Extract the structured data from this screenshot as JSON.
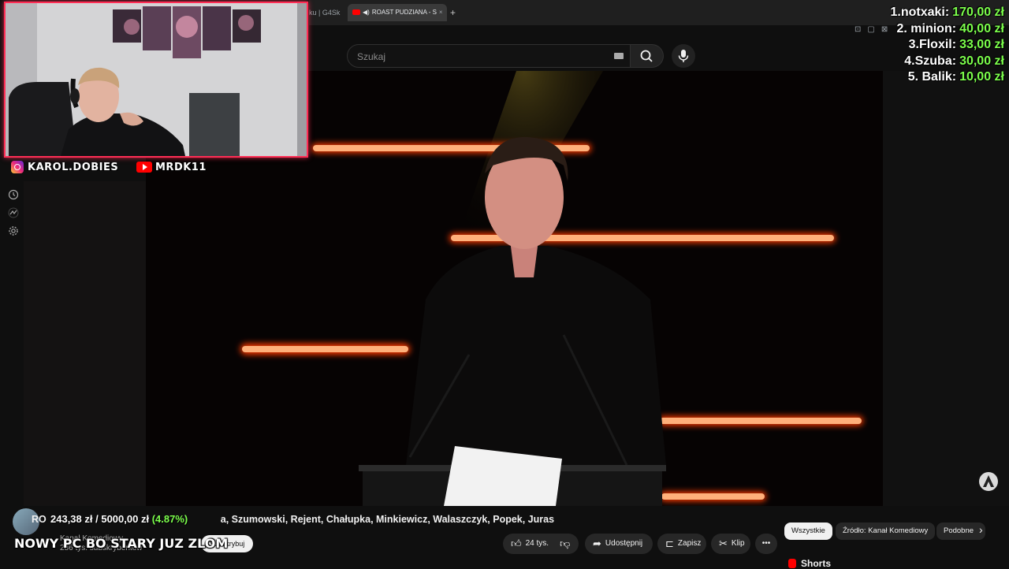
{
  "browser": {
    "prev_tab_label": "ku | G4Sk",
    "active_tab_label": "ROAST PUDZIANA - S",
    "new_tab_symbol": "+"
  },
  "search": {
    "placeholder": "Szukaj"
  },
  "overlay": {
    "instagram_handle": "KAROL.DOBIES",
    "youtube_handle": "MRDK11",
    "stream_title": "NOWY PC BO STARY JUZ ZLOM",
    "donation_goal": {
      "current": "243,38 zł",
      "separator": " / ",
      "target": "5000,00 zł",
      "percent": "(4.87%)"
    }
  },
  "leaderboard": [
    {
      "rank_name": "1.notxaki:",
      "amount": "170,00 zł"
    },
    {
      "rank_name": "2. minion:",
      "amount": "40,00 zł"
    },
    {
      "rank_name": "3.Floxil:",
      "amount": "33,00 zł"
    },
    {
      "rank_name": "4.Szuba:",
      "amount": "30,00 zł"
    },
    {
      "rank_name": "5. Balik:",
      "amount": "10,00 zł"
    }
  ],
  "video": {
    "title_prefix": "RO",
    "title_rest": "a, Szumowski, Rejent, Chałupka, Minkiewicz, Walaszczyk, Popek, Juras",
    "channel_name": "Kanał Komediowy",
    "subscribers": "286 tys. subskrybentów",
    "subscribe_label": "Subskrybuj"
  },
  "actions": {
    "likes": "24 tys.",
    "share": "Udostępnij",
    "save": "Zapisz",
    "clip": "Klip",
    "more": "•••"
  },
  "chips": [
    "Wszystkie",
    "Źródło: Kanał Komediowy",
    "Podobne"
  ],
  "shorts_label": "Shorts",
  "colors": {
    "accent_red": "#ff0000",
    "cam_border": "#ff2d55",
    "money_green": "#7cff4c"
  }
}
